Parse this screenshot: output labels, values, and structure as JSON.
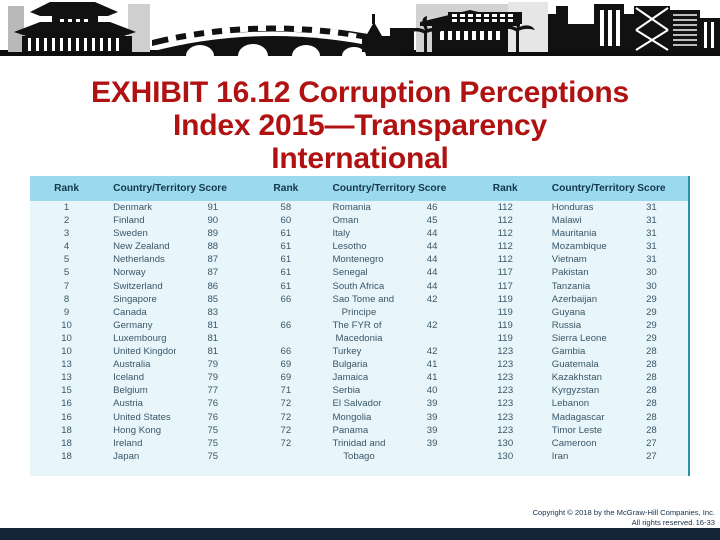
{
  "banner": {
    "alt": "city-skyline-silhouette-banner"
  },
  "title": {
    "line1": "EXHIBIT 16.12 Corruption Perceptions",
    "line2": "Index 2015—Transparency",
    "line3": "International",
    "color": "#b01212"
  },
  "table": {
    "header_bg": "#9ad9ee",
    "body_bg": "#e8f6fb",
    "header_text_color": "#14364a",
    "body_text_color": "#3b5668",
    "columns": [
      "Rank",
      "Country/Territory",
      "Score",
      "Rank",
      "Country/Territory",
      "Score",
      "Rank",
      "Country/Territory",
      "Score"
    ],
    "rows": [
      [
        "1",
        "Denmark",
        "91",
        "58",
        "Romania",
        "46",
        "112",
        "Honduras",
        "31"
      ],
      [
        "2",
        "Finland",
        "90",
        "60",
        "Oman",
        "45",
        "112",
        "Malawi",
        "31"
      ],
      [
        "3",
        "Sweden",
        "89",
        "61",
        "Italy",
        "44",
        "112",
        "Mauritania",
        "31"
      ],
      [
        "4",
        "New Zealand",
        "88",
        "61",
        "Lesotho",
        "44",
        "112",
        "Mozambique",
        "31"
      ],
      [
        "5",
        "Netherlands",
        "87",
        "61",
        "Montenegro",
        "44",
        "112",
        "Vietnam",
        "31"
      ],
      [
        "5",
        "Norway",
        "87",
        "61",
        "Senegal",
        "44",
        "117",
        "Pakistan",
        "30"
      ],
      [
        "7",
        "Switzerland",
        "86",
        "61",
        "South Africa",
        "44",
        "117",
        "Tanzania",
        "30"
      ],
      [
        "8",
        "Singapore",
        "85",
        "66",
        "Sao Tome and",
        "42",
        "119",
        "Azerbaijan",
        "29"
      ],
      [
        "9",
        "Canada",
        "83",
        "",
        "Principe",
        "",
        "119",
        "Guyana",
        "29"
      ],
      [
        "10",
        "Germany",
        "81",
        "66",
        "The FYR of",
        "42",
        "119",
        "Russia",
        "29"
      ],
      [
        "10",
        "Luxembourg",
        "81",
        "",
        "Macedonia",
        "",
        "119",
        "Sierra Leone",
        "29"
      ],
      [
        "10",
        "United Kingdom",
        "81",
        "66",
        "Turkey",
        "42",
        "123",
        "Gambia",
        "28"
      ],
      [
        "13",
        "Australia",
        "79",
        "69",
        "Bulgaria",
        "41",
        "123",
        "Guatemala",
        "28"
      ],
      [
        "13",
        "Iceland",
        "79",
        "69",
        "Jamaica",
        "41",
        "123",
        "Kazakhstan",
        "28"
      ],
      [
        "15",
        "Belgium",
        "77",
        "71",
        "Serbia",
        "40",
        "123",
        "Kyrgyzstan",
        "28"
      ],
      [
        "16",
        "Austria",
        "76",
        "72",
        "El Salvador",
        "39",
        "123",
        "Lebanon",
        "28"
      ],
      [
        "16",
        "United States",
        "76",
        "72",
        "Mongolia",
        "39",
        "123",
        "Madagascar",
        "28"
      ],
      [
        "18",
        "Hong Kong",
        "75",
        "72",
        "Panama",
        "39",
        "123",
        "Timor Leste",
        "28"
      ],
      [
        "18",
        "Ireland",
        "75",
        "72",
        "Trinidad and",
        "39",
        "130",
        "Cameroon",
        "27"
      ],
      [
        "18",
        "Japan",
        "75",
        "",
        "Tobago",
        "",
        "130",
        "Iran",
        "27"
      ]
    ]
  },
  "footer": {
    "copyright": "Copyright © 2018 by the McGraw-Hill Companies, Inc.",
    "rights": "All rights reserved.",
    "slide_number": "16-33"
  }
}
